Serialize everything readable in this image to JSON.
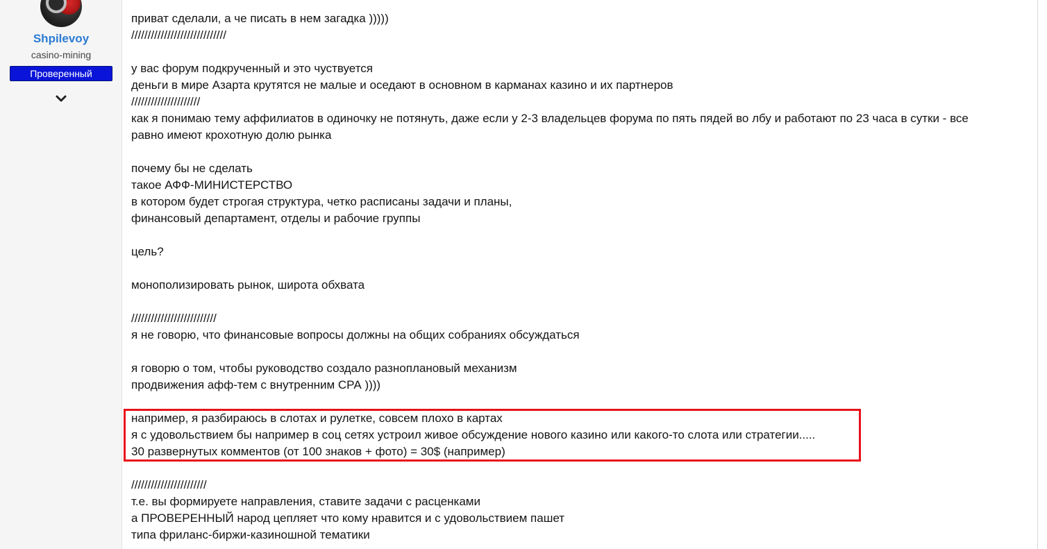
{
  "user": {
    "name": "Shpilevoy",
    "title": "casino-mining",
    "badge": "Проверенный",
    "expand_icon": "chevron-down-icon"
  },
  "post": {
    "lines": [
      "приват сделали, а че писать в нем загадка )))))",
      "/////////////////////////////",
      "",
      "у вас форум подкрученный и это чуствуется",
      "деньги в мире Азарта крутятся не малые и оседают в основном в карманах казино и их партнеров",
      "/////////////////////",
      "как я понимаю тему аффилиатов в одиночку не потянуть, даже если у 2-3 владельцев форума по пять пядей во лбу и работают по 23 часа в сутки - все",
      "равно имеют крохотную долю рынка",
      "",
      "почему бы не сделать",
      "такое АФФ-МИНИСТЕРСТВО",
      "в котором будет строгая структура, четко расписаны задачи и планы,",
      "финансовый департамент, отделы и рабочие группы",
      "",
      "цель?",
      "",
      "монополизировать рынок, широта обхвата",
      "",
      "//////////////////////////",
      "я не говорю, что финансовые вопросы должны на общих собраниях обсуждаться",
      "",
      "я говорю о том, чтобы руководство создало разноплановый механизм",
      "продвижения афф-тем с внутренним СРА ))))",
      "",
      "например, я разбираюсь в слотах и рулетке, совсем плохо в картах",
      "я с удовольствием бы например в соц сетях устроил живое обсуждение нового казино или какого-то слота или стратегии.....",
      "30 развернутых комментов (от 100 знаков + фото) = 30$ (например)",
      "",
      "///////////////////////",
      "т.е. вы формируете направления, ставите задачи с расценками",
      "а ПРОВЕРЕННЫЙ народ цепляет что кому нравится и с удовольствием пашет",
      "типа фриланс-биржи-казиношной тематики"
    ]
  },
  "colors": {
    "username": "#2a7bd3",
    "badge_bg": "#0a14d8",
    "highlight_border": "#e8121b"
  }
}
